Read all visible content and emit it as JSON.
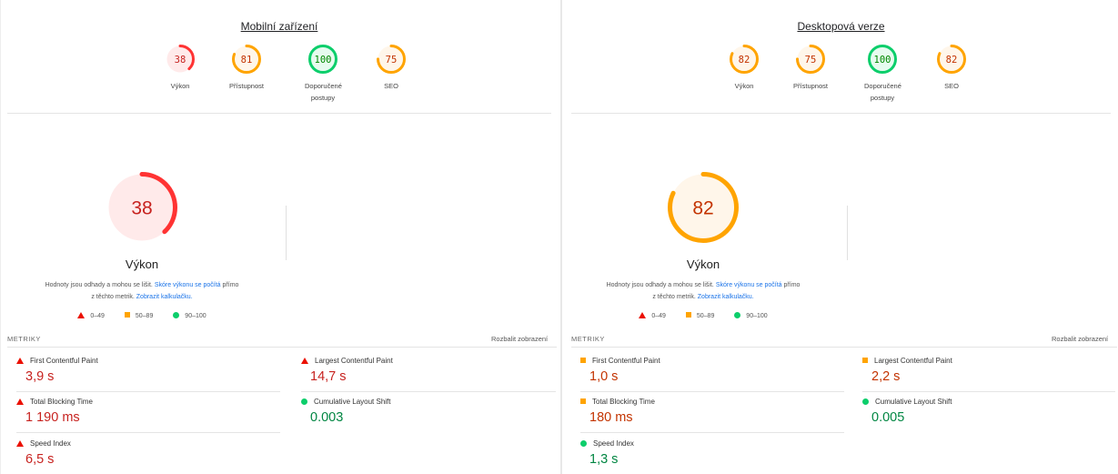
{
  "mobile": {
    "title": "Mobilní zařízení",
    "gauges": [
      {
        "score": "38",
        "label": "Výkon",
        "rating": "fail",
        "fraction": 0.38
      },
      {
        "score": "81",
        "label": "Přístupnost",
        "rating": "average",
        "fraction": 0.81
      },
      {
        "score": "100",
        "label": "Doporučené postupy",
        "rating": "pass",
        "fraction": 1.0
      },
      {
        "score": "75",
        "label": "SEO",
        "rating": "average",
        "fraction": 0.75
      }
    ],
    "big_score": "38",
    "big_fraction": 0.38,
    "big_title": "Výkon",
    "desc_part1": "Hodnoty jsou odhady a mohou se lišit.",
    "desc_link1": "Skóre výkonu se počítá",
    "desc_part2": "přímo",
    "desc_part3": "z těchto metrik.",
    "desc_link2": "Zobrazit kalkulačku.",
    "legend": [
      "0–49",
      "50–89",
      "90–100"
    ],
    "metrics_label": "METRIKY",
    "expand_label": "Rozbalit zobrazení",
    "metrics": [
      {
        "name": "First Contentful Paint",
        "value": "3,9 s",
        "rating": "fail"
      },
      {
        "name": "Largest Contentful Paint",
        "value": "14,7 s",
        "rating": "fail"
      },
      {
        "name": "Total Blocking Time",
        "value": "1 190 ms",
        "rating": "fail"
      },
      {
        "name": "Cumulative Layout Shift",
        "value": "0.003",
        "rating": "pass"
      },
      {
        "name": "Speed Index",
        "value": "6,5 s",
        "rating": "fail"
      }
    ]
  },
  "desktop": {
    "title": "Desktopová verze",
    "gauges": [
      {
        "score": "82",
        "label": "Výkon",
        "rating": "average",
        "fraction": 0.82
      },
      {
        "score": "75",
        "label": "Přístupnost",
        "rating": "average",
        "fraction": 0.75
      },
      {
        "score": "100",
        "label": "Doporučené postupy",
        "rating": "pass",
        "fraction": 1.0
      },
      {
        "score": "82",
        "label": "SEO",
        "rating": "average",
        "fraction": 0.82
      }
    ],
    "big_score": "82",
    "big_fraction": 0.82,
    "big_title": "Výkon",
    "desc_part1": "Hodnoty jsou odhady a mohou se lišit.",
    "desc_link1": "Skóre výkonu se počítá",
    "desc_part2": "přímo",
    "desc_part3": "z těchto metrik.",
    "desc_link2": "Zobrazit kalkulačku.",
    "legend": [
      "0–49",
      "50–89",
      "90–100"
    ],
    "metrics_label": "METRIKY",
    "expand_label": "Rozbalit zobrazení",
    "metrics": [
      {
        "name": "First Contentful Paint",
        "value": "1,0 s",
        "rating": "average"
      },
      {
        "name": "Largest Contentful Paint",
        "value": "2,2 s",
        "rating": "average"
      },
      {
        "name": "Total Blocking Time",
        "value": "180 ms",
        "rating": "average"
      },
      {
        "name": "Cumulative Layout Shift",
        "value": "0.005",
        "rating": "pass"
      },
      {
        "name": "Speed Index",
        "value": "1,3 s",
        "rating": "pass"
      }
    ]
  },
  "colors": {
    "fail": "#ff3333",
    "fail_bg": "#ffeaea",
    "fail_text": "#c7221f",
    "average": "#ffa400",
    "average_bg": "#fff6ea",
    "average_text": "#c33300",
    "pass": "#0cce6b",
    "pass_bg": "#e6fbef",
    "pass_text": "#008800"
  }
}
